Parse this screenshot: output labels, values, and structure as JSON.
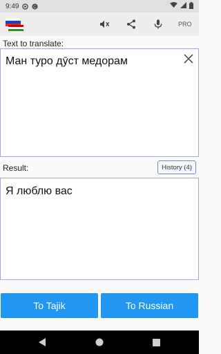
{
  "status_bar": {
    "time": "9:49"
  },
  "toolbar": {
    "pro_label": "PRO"
  },
  "input": {
    "label": "Text to translate:",
    "value": "Ман туро дӯст медорам"
  },
  "result": {
    "label": "Result:",
    "value": "Я люблю вас",
    "history_label": "History (4)"
  },
  "buttons": {
    "to_tajik": "To Tajik",
    "to_russian": "To Russian"
  },
  "colors": {
    "accent": "#2196f3",
    "box_border": "#9fa8da",
    "toolbar_bg": "#eeeeee"
  }
}
